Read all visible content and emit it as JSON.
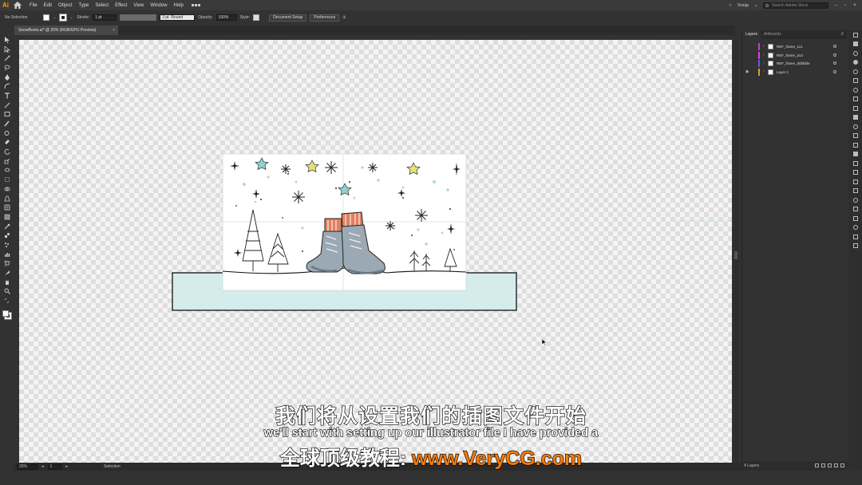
{
  "menubar": {
    "app_logo": "Ai",
    "items": [
      "File",
      "Edit",
      "Object",
      "Type",
      "Select",
      "Effect",
      "View",
      "Window",
      "Help"
    ],
    "user": "Sonja",
    "search_placeholder": "Search Adobe Stock"
  },
  "controlbar": {
    "selection": "No Selection",
    "stroke_label": "Stroke:",
    "stroke_value": "1 pt",
    "brush_value": "3 pt. Round",
    "opacity_label": "Opacity:",
    "opacity_value": "100%",
    "style_label": "Style:",
    "document_setup": "Document Setup",
    "preferences": "Preferences"
  },
  "document": {
    "tab_title": "SnowBoots.ai* @ 25% (RGB/GPU Preview)",
    "close": "×"
  },
  "statusbar": {
    "zoom": "25%",
    "page": "1",
    "tool": "Selection"
  },
  "layers_panel": {
    "tabs": [
      "Layers",
      "Artboards"
    ],
    "layers": [
      {
        "name": "REF_frame_1x1",
        "color": "#c13fbf"
      },
      {
        "name": "REF_frame_2x3",
        "color": "#e040e0"
      },
      {
        "name": "REF_frame_dribbble",
        "color": "#5561e0"
      },
      {
        "name": "Layer 1",
        "color": "#d8a020",
        "visible": true
      }
    ],
    "footer": "4 Layers"
  },
  "subtitles": {
    "chinese": "我们将从设置我们的插图文件开始",
    "english": "we'll start with setting up our illustrator file I have provided a",
    "site_prefix": "全球顶级教程: ",
    "site_url": "www.VeryCG.com"
  },
  "colors": {
    "canvas_ground": "#d5ecec",
    "star_yellow": "#e9e07a",
    "star_teal": "#8fd2d2",
    "boot_grey": "#9aa9b4",
    "sock_orange": "#e08060"
  }
}
